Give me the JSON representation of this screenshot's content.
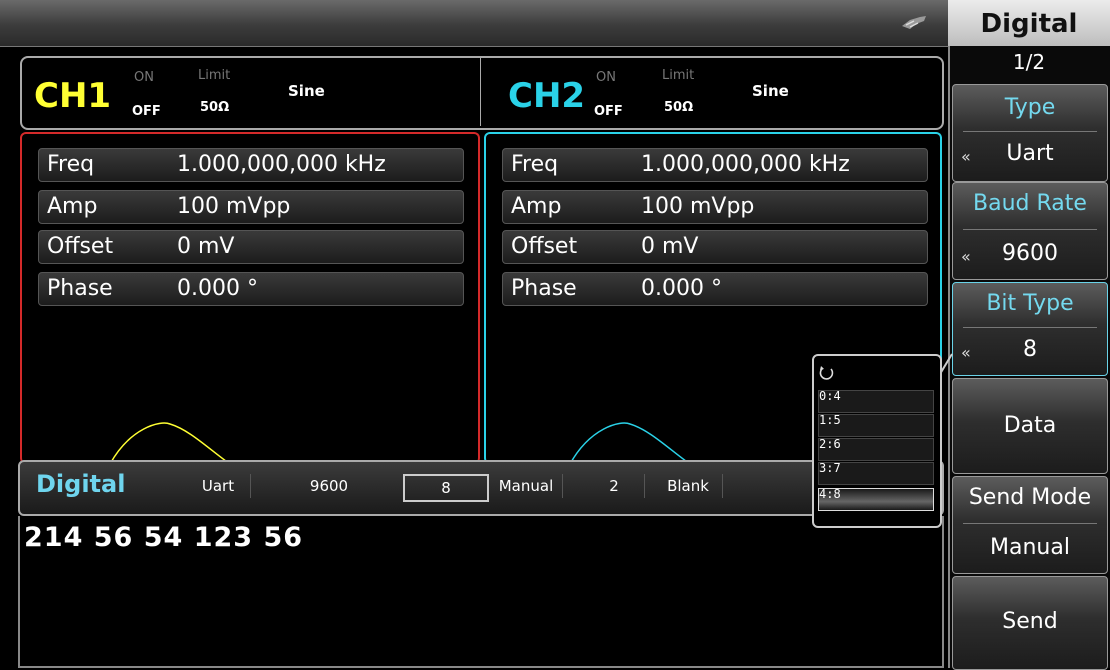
{
  "header": {
    "usb_icon": "usb-icon"
  },
  "menu": {
    "title": "Digital",
    "page": "1/2",
    "type_label": "Type",
    "type_value": "Uart",
    "baud_label": "Baud Rate",
    "baud_value": "9600",
    "bittype_label": "Bit Type",
    "bittype_value": "8",
    "data_label": "Data",
    "sendmode_label": "Send Mode",
    "sendmode_value": "Manual",
    "send_label": "Send",
    "arrow": "«"
  },
  "ch1": {
    "name": "CH1",
    "on": "ON",
    "off": "OFF",
    "limit": "Limit",
    "imp": "50Ω",
    "wave": "Sine",
    "color": "#ffff33",
    "params": [
      {
        "name": "Freq",
        "value": "1.000,000,000 kHz"
      },
      {
        "name": "Amp",
        "value": "100 mVpp"
      },
      {
        "name": "Offset",
        "value": "0 mV"
      },
      {
        "name": "Phase",
        "value": "0.000 °"
      }
    ]
  },
  "ch2": {
    "name": "CH2",
    "on": "ON",
    "off": "OFF",
    "limit": "Limit",
    "imp": "50Ω",
    "wave": "Sine",
    "color": "#2ad2e8",
    "params": [
      {
        "name": "Freq",
        "value": "1.000,000,000 kHz"
      },
      {
        "name": "Amp",
        "value": "100 mVpp"
      },
      {
        "name": "Offset",
        "value": "0 mV"
      },
      {
        "name": "Phase",
        "value": "0.000 °"
      }
    ]
  },
  "digital": {
    "label": "Digital",
    "fields": [
      "Uart",
      "9600",
      "8",
      "Manual",
      "2",
      "Blank"
    ],
    "data": "214 56 54 123 56"
  },
  "popup": {
    "icon": "refresh-icon",
    "items": [
      "0:4",
      "1:5",
      "2:6",
      "3:7",
      "4:8"
    ],
    "selected": "4:8"
  }
}
